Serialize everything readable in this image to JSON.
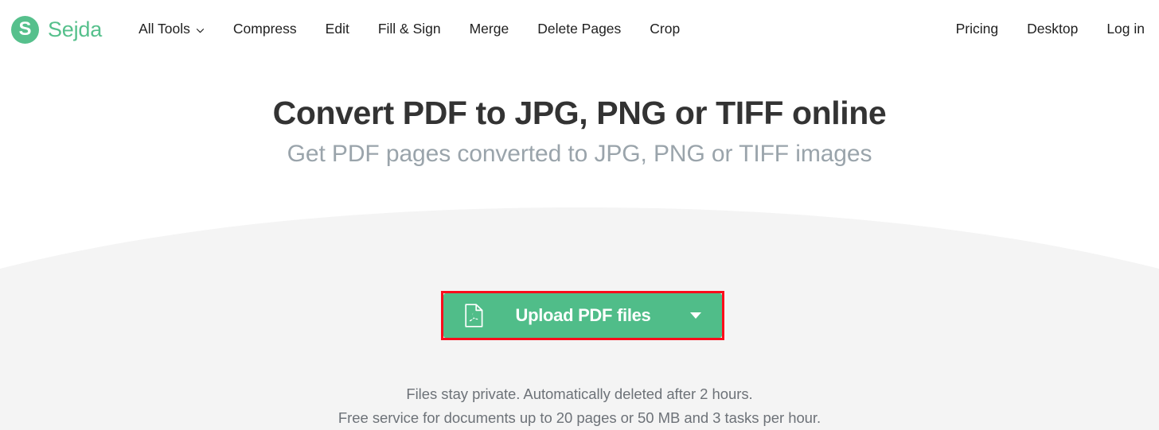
{
  "brand": {
    "mark_letter": "S",
    "name": "Sejda",
    "mark_color": "#56c08c",
    "name_color": "#56c08c"
  },
  "nav": {
    "left_items": [
      {
        "label": "All Tools",
        "has_dropdown": true,
        "icon": "chevron-down-icon"
      },
      {
        "label": "Compress",
        "has_dropdown": false
      },
      {
        "label": "Edit",
        "has_dropdown": false
      },
      {
        "label": "Fill & Sign",
        "has_dropdown": false
      },
      {
        "label": "Merge",
        "has_dropdown": false
      },
      {
        "label": "Delete Pages",
        "has_dropdown": false
      },
      {
        "label": "Crop",
        "has_dropdown": false
      }
    ],
    "right_items": [
      {
        "label": "Pricing"
      },
      {
        "label": "Desktop"
      },
      {
        "label": "Log in"
      }
    ]
  },
  "hero": {
    "title": "Convert PDF to JPG, PNG or TIFF online",
    "subtitle": "Get PDF pages converted to JPG, PNG or TIFF images",
    "title_color": "#333333",
    "subtitle_color": "#9aa4ab"
  },
  "upload": {
    "label": "Upload PDF files",
    "file_icon": "pdf-document-icon",
    "dropdown_icon": "caret-down-icon",
    "button_color": "#50bd89",
    "text_color": "#ffffff",
    "highlight_border_color": "#fc0d1b"
  },
  "footnotes": [
    "Files stay private. Automatically deleted after 2 hours.",
    "Free service for documents up to 20 pages or 50 MB and 3 tasks per hour."
  ],
  "background": {
    "top_color": "#ffffff",
    "bottom_color": "#f4f4f4"
  }
}
